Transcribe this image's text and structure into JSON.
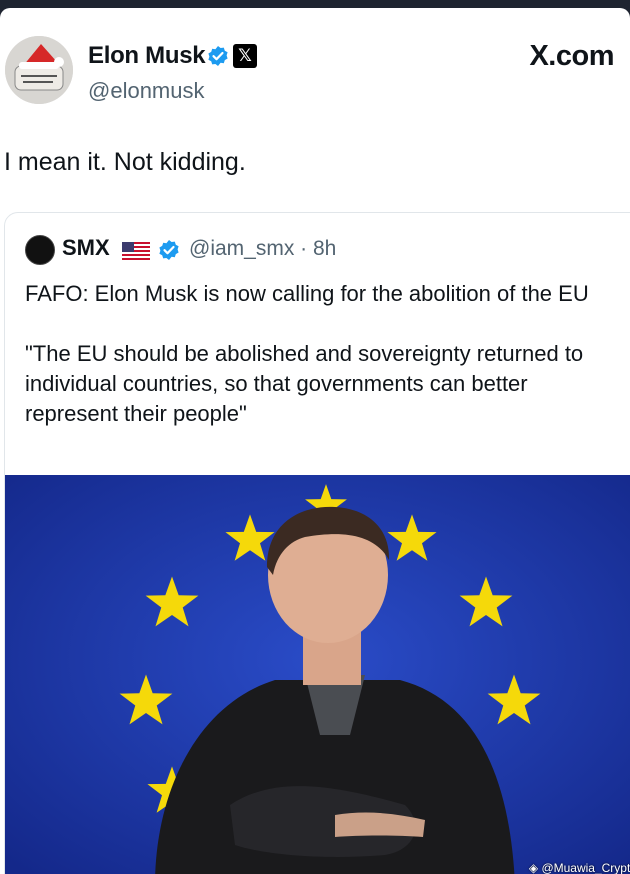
{
  "tweet": {
    "author_name": "Elon Musk",
    "author_handle": "@elonmusk",
    "brand": "X.com",
    "text": "I mean it. Not kidding."
  },
  "quote": {
    "author_name": "SMX",
    "author_handle": "@iam_smx",
    "time": "8h",
    "meta": "@iam_smx · 8h",
    "paragraph_1": "FAFO: Elon Musk is now calling for the abolition of the EU",
    "paragraph_2": "\"The EU should be abolished and sovereignty returned to individual countries, so that governments can better represent their people\""
  },
  "watermark": "◈ @Muawia_Crypto",
  "icons": {
    "verified": "verified-badge-icon",
    "x_logo": "x-logo-icon",
    "flag": "us-flag-icon"
  },
  "colors": {
    "verified_blue": "#1d9bf0",
    "handle_gray": "#536471",
    "eu_blue": "#1e3aa8",
    "eu_star": "#f5d90a"
  }
}
